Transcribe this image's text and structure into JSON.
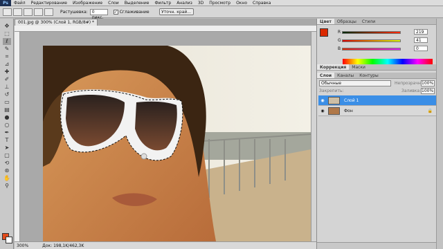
{
  "menubar": {
    "logo": "Ps",
    "items": [
      "Файл",
      "Редактирование",
      "Изображение",
      "Слои",
      "Выделение",
      "Фильтр",
      "Анализ",
      "3D",
      "Просмотр",
      "Окно",
      "Справка"
    ]
  },
  "options": {
    "feather_label": "Растушевка:",
    "feather_value": "0 пикс.",
    "antialias_label": "Сглаживание",
    "antialias_checked": "✓",
    "refine_edge": "Уточн. край..."
  },
  "document": {
    "tab_title": "001.jpg @ 300% (Слой 1, RGB/8#) *",
    "zoom": "300%",
    "doc_info": "Док: 198,1K/462,3K"
  },
  "color_panel": {
    "tabs": [
      "Цвет",
      "Образцы",
      "Стили"
    ],
    "r_label": "R",
    "g_label": "G",
    "b_label": "B",
    "r": "219",
    "g": "41",
    "b": "0",
    "fg_color": "#db2900",
    "bg_color": "#ffffff"
  },
  "adjust_panel": {
    "tabs": [
      "Коррекция",
      "Маски"
    ]
  },
  "layers_panel": {
    "tabs": [
      "Слои",
      "Каналы",
      "Контуры"
    ],
    "blend_mode": "Обычные",
    "opacity_label": "Непрозрачность:",
    "opacity": "100%",
    "lock_label": "Закрепить:",
    "fill_label": "Заливка:",
    "fill": "100%",
    "layers": [
      {
        "name": "Слой 1",
        "selected": true
      },
      {
        "name": "Фон",
        "selected": false
      }
    ]
  }
}
